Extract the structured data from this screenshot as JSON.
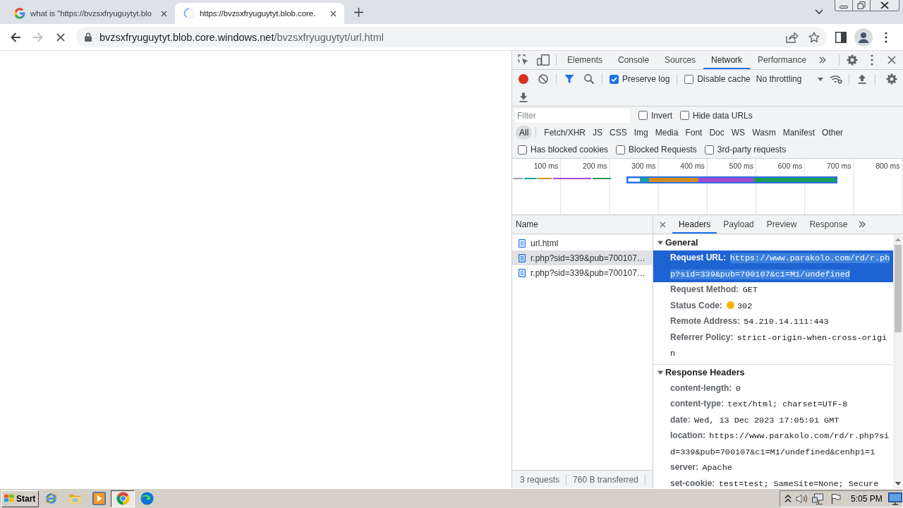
{
  "browser": {
    "tabs": [
      {
        "title": "what is \"https://bvzsxfryuguytyt.blo",
        "selected": false,
        "loading": false
      },
      {
        "title": "https://bvzsxfryuguytyt.blob.core.",
        "selected": true,
        "loading": true
      }
    ],
    "nav": {
      "back_disabled": false,
      "forward_disabled": true,
      "loading": true
    },
    "address": {
      "host": "bvzsxfryuguytyt.blob.core.windows.net",
      "path": "/bvzsxfryuguytyt/url.html"
    }
  },
  "devtools": {
    "panel_tabs": [
      {
        "label": "Elements",
        "selected": false
      },
      {
        "label": "Console",
        "selected": false
      },
      {
        "label": "Sources",
        "selected": false
      },
      {
        "label": "Network",
        "selected": true
      },
      {
        "label": "Performance",
        "selected": false
      }
    ],
    "toolbar": {
      "recording": true,
      "preserve_log": {
        "label": "Preserve log",
        "checked": true
      },
      "disable_cache": {
        "label": "Disable cache",
        "checked": false
      },
      "throttling": "No throttling"
    },
    "filter": {
      "placeholder": "Filter",
      "options": [
        {
          "label": "Invert",
          "checked": false
        },
        {
          "label": "Hide data URLs",
          "checked": false
        }
      ]
    },
    "type_filters": [
      {
        "label": "All",
        "selected": true
      },
      {
        "label": "Fetch/XHR",
        "selected": false
      },
      {
        "label": "JS",
        "selected": false
      },
      {
        "label": "CSS",
        "selected": false
      },
      {
        "label": "Img",
        "selected": false
      },
      {
        "label": "Media",
        "selected": false
      },
      {
        "label": "Font",
        "selected": false
      },
      {
        "label": "Doc",
        "selected": false
      },
      {
        "label": "WS",
        "selected": false
      },
      {
        "label": "Wasm",
        "selected": false
      },
      {
        "label": "Manifest",
        "selected": false
      },
      {
        "label": "Other",
        "selected": false
      }
    ],
    "extra_filters": [
      {
        "label": "Has blocked cookies",
        "checked": false
      },
      {
        "label": "Blocked Requests",
        "checked": false
      },
      {
        "label": "3rd-party requests",
        "checked": false
      }
    ],
    "timeline": {
      "ticks": [
        "100 ms",
        "200 ms",
        "300 ms",
        "400 ms",
        "500 ms",
        "600 ms",
        "700 ms",
        "800 ms"
      ]
    },
    "requests": {
      "column": "Name",
      "rows": [
        {
          "name": "url.html",
          "selected": false
        },
        {
          "name": "r.php?sid=339&pub=700107…",
          "selected": true
        },
        {
          "name": "r.php?sid=339&pub=700107…",
          "selected": false
        }
      ]
    },
    "status_bar": [
      "3 requests",
      "760 B transferred"
    ],
    "details": {
      "tabs": [
        {
          "label": "Headers",
          "selected": true
        },
        {
          "label": "Payload",
          "selected": false
        },
        {
          "label": "Preview",
          "selected": false
        },
        {
          "label": "Response",
          "selected": false
        }
      ],
      "sections": [
        {
          "title": "General",
          "expanded": true,
          "rows": [
            {
              "name": "Request URL:",
              "value": "https://www.parakolo.com/rd/r.php?sid=339&pub=700107&c1=M1/undefined",
              "highlighted": true
            },
            {
              "name": "Request Method:",
              "value": "GET",
              "highlighted": false
            },
            {
              "name": "Status Code:",
              "value": "302",
              "highlighted": false,
              "color": "#f6b40e"
            },
            {
              "name": "Remote Address:",
              "value": "54.210.14.111:443",
              "highlighted": false
            },
            {
              "name": "Referrer Policy:",
              "value": "strict-origin-when-cross-origin",
              "highlighted": false
            }
          ]
        },
        {
          "title": "Response Headers",
          "expanded": true,
          "rows": [
            {
              "name": "content-length:",
              "value": "0",
              "highlighted": false
            },
            {
              "name": "content-type:",
              "value": "text/html; charset=UTF-8",
              "highlighted": false
            },
            {
              "name": "date:",
              "value": "Wed, 13 Dec 2023 17:05:01 GMT",
              "highlighted": false
            },
            {
              "name": "location:",
              "value": "https://www.parakolo.com/rd/r.php?sid=339&pub=700107&c1=M1/undefined&cenhp1=1",
              "highlighted": false
            },
            {
              "name": "server:",
              "value": "Apache",
              "highlighted": false
            },
            {
              "name": "set-cookie:",
              "value": "test=test; SameSite=None; Secure",
              "highlighted": false
            }
          ]
        }
      ]
    }
  },
  "taskbar": {
    "start": "Start",
    "apps": [
      {
        "kind": "ie",
        "active": false
      },
      {
        "kind": "folder",
        "active": false
      },
      {
        "kind": "media",
        "active": false
      },
      {
        "kind": "chrome",
        "active": true
      },
      {
        "kind": "edge",
        "active": false
      }
    ],
    "clock": "5:05 PM"
  }
}
